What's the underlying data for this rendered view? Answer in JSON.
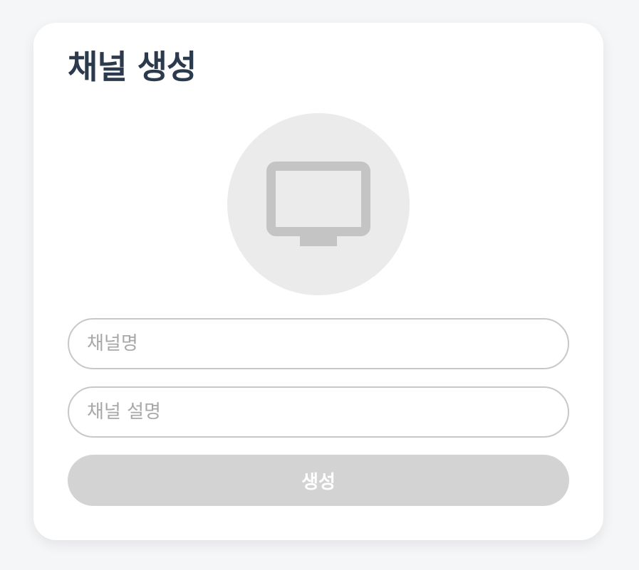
{
  "dialog": {
    "title": "채널 생성"
  },
  "thumbnail": {
    "icon": "tv-icon",
    "colors": {
      "background": "#ebebeb",
      "icon": "#c4c4c4"
    }
  },
  "form": {
    "name_placeholder": "채널명",
    "name_value": "",
    "description_placeholder": "채널 설명",
    "description_value": ""
  },
  "actions": {
    "create_label": "생성",
    "create_enabled": false
  },
  "colors": {
    "title": "#2b3a4d",
    "input_border": "#c8c8c8",
    "placeholder": "#a8a8a8",
    "button_disabled_bg": "#d3d3d3",
    "button_text": "#ffffff"
  }
}
